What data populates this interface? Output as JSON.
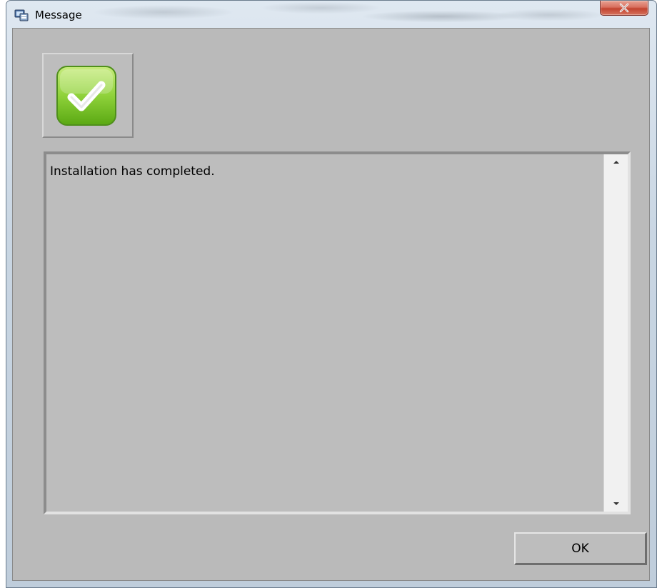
{
  "window": {
    "title": "Message",
    "icons": {
      "app": "setup-app-icon",
      "close": "close-icon"
    }
  },
  "status": {
    "icon": "checkmark-success-icon",
    "accent": "#7ac142"
  },
  "message": {
    "text": "Installation has completed."
  },
  "scrollbar": {
    "up_icon": "scroll-up-arrow-icon",
    "down_icon": "scroll-down-arrow-icon"
  },
  "buttons": {
    "ok_label": "OK"
  },
  "colors": {
    "client_background": "#bababa",
    "close_button": "#c2432f"
  }
}
